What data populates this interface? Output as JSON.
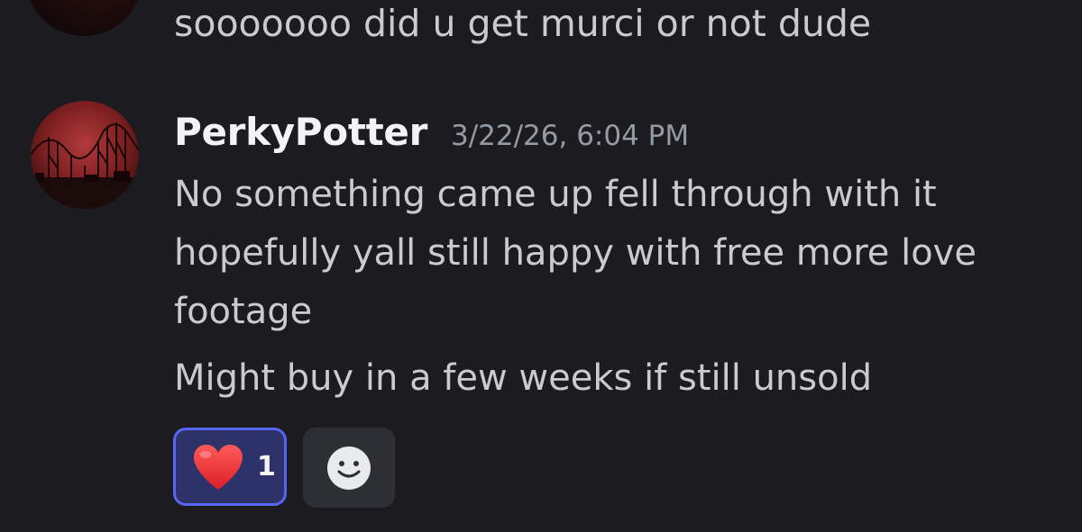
{
  "previous_message": {
    "text": "sooooooo did u get murci or not dude"
  },
  "message": {
    "username": "PerkyPotter",
    "timestamp": "3/22/26, 6:04 PM",
    "lines": [
      "No something came up fell through with it hopefully yall still happy with free more love footage",
      "Might buy in a few weeks if still unsold"
    ]
  },
  "reactions": [
    {
      "emoji": "heart-emoji",
      "count": "1",
      "selected": true
    }
  ],
  "add_reaction": {
    "icon": "smiley-icon"
  },
  "colors": {
    "background": "#1b1b20",
    "text": "#c9cbcf",
    "username": "#f2f3f5",
    "timestamp": "#949ba4",
    "reaction_border": "#5865f2",
    "reaction_bg": "#2d3369"
  }
}
